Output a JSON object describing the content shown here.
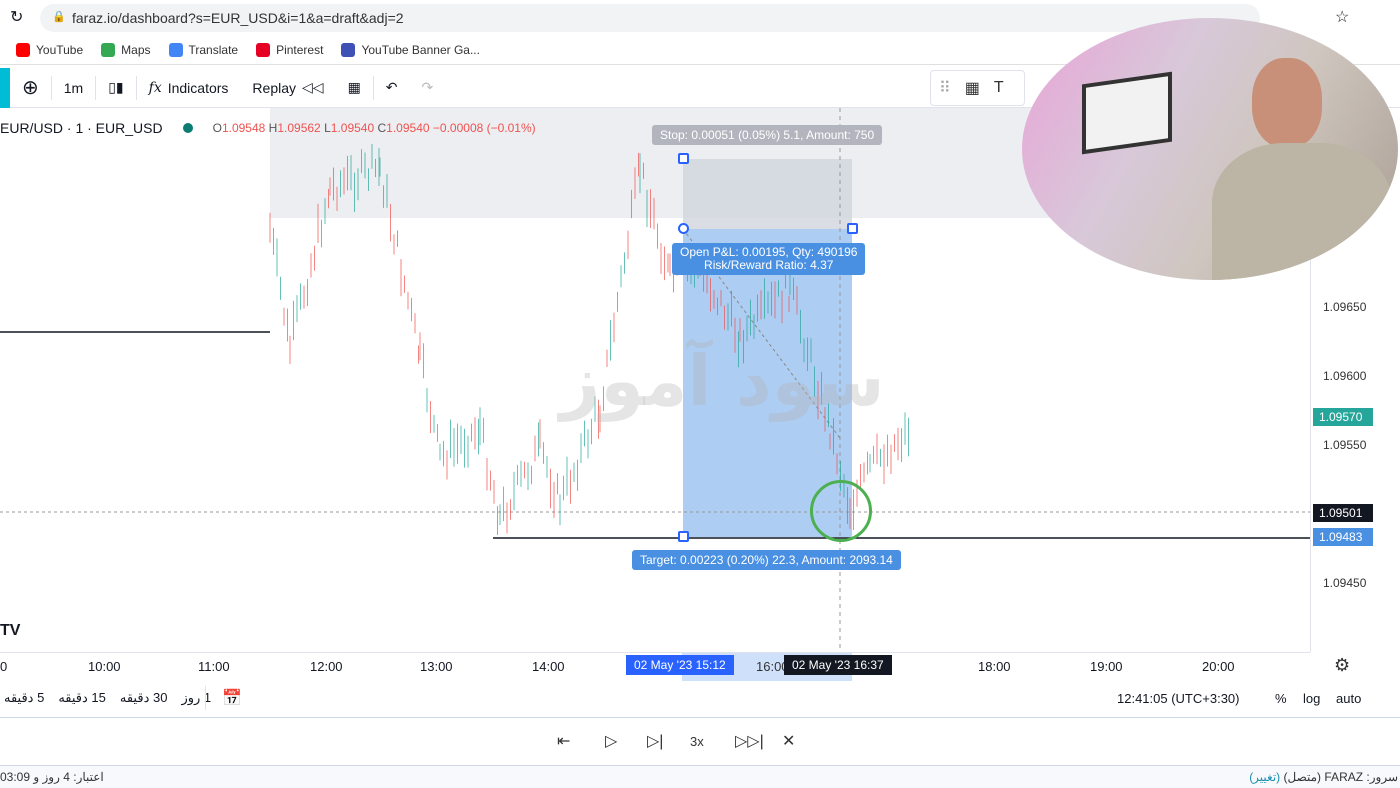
{
  "browser": {
    "url": "faraz.io/dashboard?s=EUR_USD&i=1&a=draft&adj=2",
    "bookmarks": [
      {
        "label": "YouTube",
        "color": "#ff0000"
      },
      {
        "label": "Maps",
        "color": "#34a853"
      },
      {
        "label": "Translate",
        "color": "#4285f4"
      },
      {
        "label": "Pinterest",
        "color": "#e60023"
      },
      {
        "label": "YouTube Banner Ga...",
        "color": "#3f51b5"
      }
    ]
  },
  "toolbar": {
    "interval": "1m",
    "indicators": "Indicators",
    "replay": "Replay"
  },
  "legend": {
    "symbol": "EUR/USD · 1 · EUR_USD",
    "o_label": "O",
    "o": "1.09548",
    "h_label": "H",
    "h": "1.09562",
    "l_label": "L",
    "l": "1.09540",
    "c_label": "C",
    "c": "1.09540",
    "change": "−0.00008 (−0.01%)"
  },
  "price_axis": {
    "labels": [
      "1.09650",
      "1.09600",
      "1.09550",
      "1.09450"
    ],
    "current_price": "1.09570",
    "crosshair_price": "1.09501",
    "target_price": "1.09483",
    "current_color": "#26a69a",
    "target_color": "#4a90e2"
  },
  "position": {
    "stop_label": "Stop: 0.00051 (0.05%) 5.1, Amount: 750",
    "pnl_line1": "Open P&L: 0.00195, Qty: 490196",
    "pnl_line2": "Risk/Reward Ratio: 4.37",
    "target_label": "Target: 0.00223 (0.20%) 22.3, Amount: 2093.14"
  },
  "time_axis": {
    "labels": [
      "0",
      "10:00",
      "11:00",
      "12:00",
      "13:00",
      "14:00",
      "18:00",
      "19:00",
      "20:00"
    ],
    "range_start": "02 May '23   15:12",
    "range_mid": "16:00",
    "crosshair": "02 May '23   16:37"
  },
  "watermark": "سود آموز",
  "bottom": {
    "ranges": [
      "5 دقیقه",
      "15 دقیقه",
      "30 دقیقه",
      "1 روز"
    ],
    "clock": "12:41:05 (UTC+3:30)",
    "percent": "%",
    "log": "log",
    "auto": "auto"
  },
  "replay": {
    "speed": "3x"
  },
  "status": {
    "left": "اعتبار: 4 روز و 03:09",
    "server": "سرور: FARAZ (متصل)",
    "change_link": "(تغییر)"
  }
}
